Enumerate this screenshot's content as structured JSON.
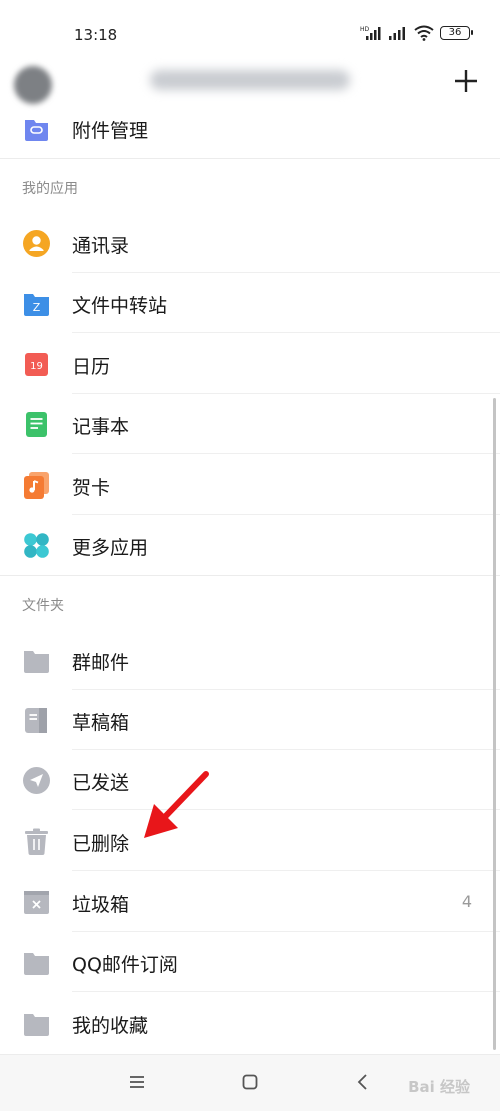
{
  "status_bar": {
    "time": "13:18",
    "network_label": "HD",
    "battery": "36"
  },
  "header": {
    "add_symbol": "+"
  },
  "top_item": {
    "label": "附件管理",
    "icon": "attachment-icon"
  },
  "sections": {
    "apps_title": "我的应用",
    "folders_title": "文件夹"
  },
  "apps": [
    {
      "label": "通讯录",
      "icon": "contacts-icon",
      "color": "#f5a623"
    },
    {
      "label": "文件中转站",
      "icon": "transfer-folder-icon",
      "color": "#3d8fe6",
      "glyph": "Z"
    },
    {
      "label": "日历",
      "icon": "calendar-icon",
      "color": "#f25c54",
      "glyph": "19"
    },
    {
      "label": "记事本",
      "icon": "notepad-icon",
      "color": "#3cc26a"
    },
    {
      "label": "贺卡",
      "icon": "greeting-card-icon",
      "color": "#f57b33"
    },
    {
      "label": "更多应用",
      "icon": "more-apps-icon",
      "color": "#3cc8d3"
    }
  ],
  "folders": [
    {
      "label": "群邮件",
      "icon": "group-mail-icon",
      "count": ""
    },
    {
      "label": "草稿箱",
      "icon": "drafts-icon",
      "count": ""
    },
    {
      "label": "已发送",
      "icon": "sent-icon",
      "count": ""
    },
    {
      "label": "已删除",
      "icon": "trash-icon",
      "count": ""
    },
    {
      "label": "垃圾箱",
      "icon": "spam-icon",
      "count": "4"
    },
    {
      "label": "QQ邮件订阅",
      "icon": "subscription-icon",
      "count": ""
    },
    {
      "label": "我的收藏",
      "icon": "favorites-icon",
      "count": ""
    }
  ],
  "watermark": "Bai 经验",
  "colors": {
    "folder_gray": "#b6b8bf",
    "accent_red": "#e8161a"
  }
}
